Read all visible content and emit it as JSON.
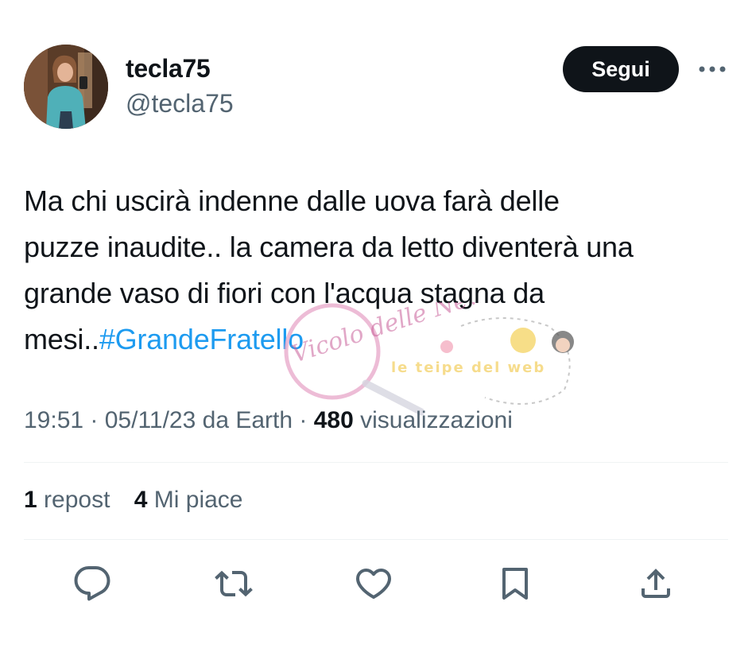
{
  "author": {
    "display_name": "tecla75",
    "handle": "@tecla75"
  },
  "header": {
    "follow_label": "Segui",
    "more_icon": "more-dots-icon"
  },
  "tweet": {
    "lines": [
      "Ma chi uscirà indenne dalle uova farà delle",
      "puzze inaudite.. la camera da letto diventerà una",
      "grande vaso di fiori con l'acqua stagna da",
      "mesi.."
    ],
    "hashtag": "#GrandeFratello"
  },
  "meta": {
    "time": "19:51",
    "sep1": " · ",
    "date": "05/11/23",
    "source": " da Earth",
    "sep2": " · ",
    "views_count": "480",
    "views_label": " visualizzazioni"
  },
  "stats": {
    "reposts_count": "1",
    "reposts_label": " repost",
    "likes_count": "4",
    "likes_label": " Mi piace"
  },
  "actions": {
    "reply_icon": "reply-icon",
    "repost_icon": "repost-icon",
    "like_icon": "heart-icon",
    "bookmark_icon": "bookmark-icon",
    "share_icon": "share-icon"
  },
  "watermarks": {
    "left_text": "Vicolo delle News",
    "right_text": "le teipe del web"
  },
  "colors": {
    "text": "#0f1419",
    "secondary": "#536471",
    "link": "#1d9bf0",
    "button_bg": "#0f1419",
    "divider": "#eff3f4"
  }
}
